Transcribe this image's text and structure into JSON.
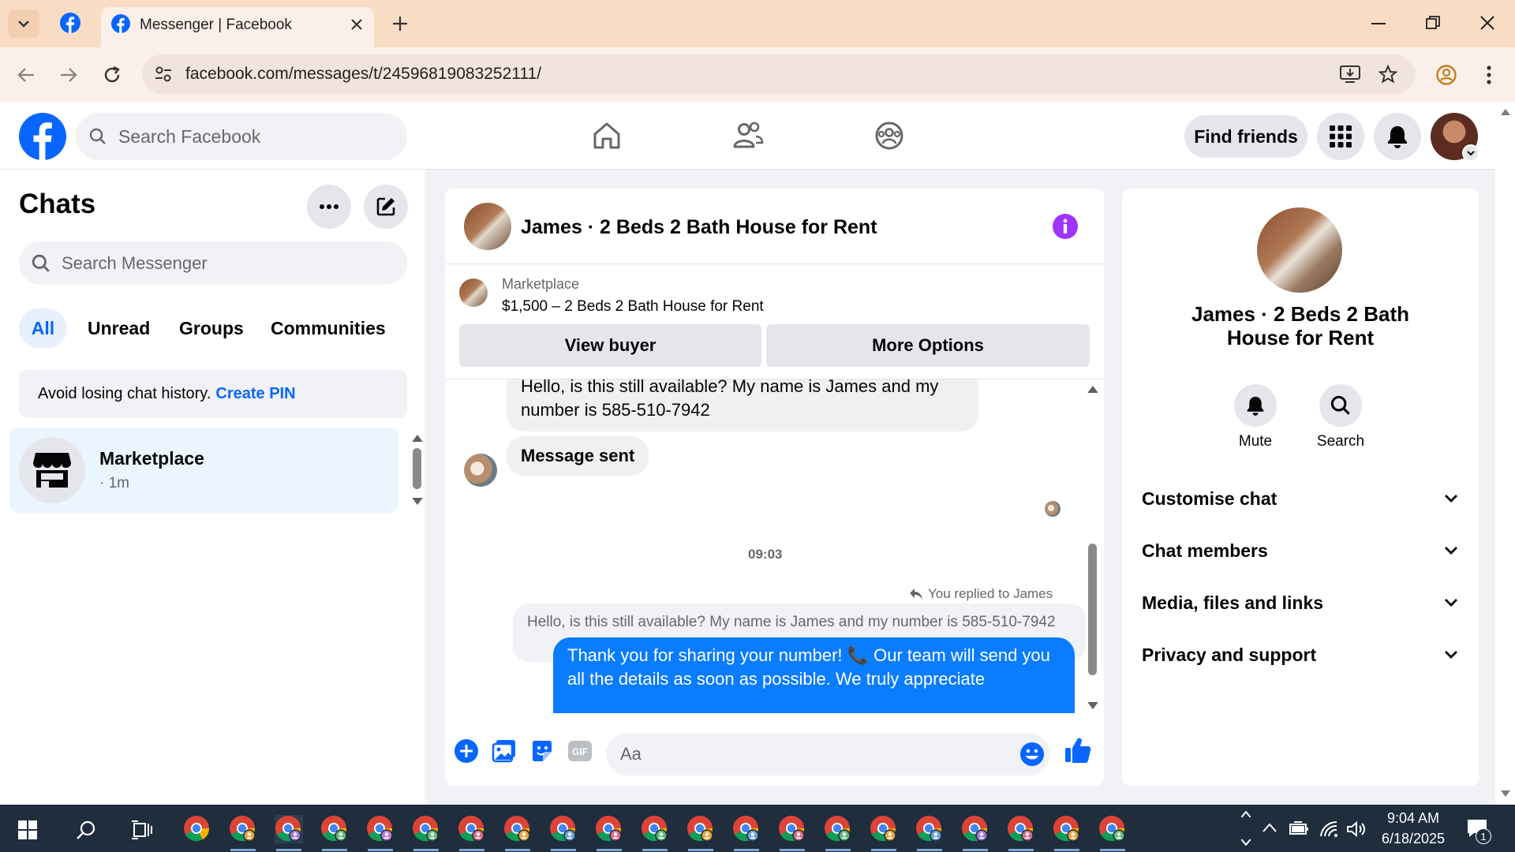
{
  "browser": {
    "tab_title": "Messenger | Facebook",
    "url": "facebook.com/messages/t/24596819083252111/"
  },
  "header": {
    "search_placeholder": "Search Facebook",
    "find_friends": "Find friends"
  },
  "sidebar": {
    "title": "Chats",
    "search_placeholder": "Search Messenger",
    "filters": [
      "All",
      "Unread",
      "Groups",
      "Communities"
    ],
    "pin_notice": "Avoid losing chat history.",
    "pin_link": "Create PIN",
    "chats": [
      {
        "name": "Marketplace",
        "time": "· 1m"
      }
    ]
  },
  "chat": {
    "title": "James · 2 Beds 2 Bath House for Rent",
    "listing_source": "Marketplace",
    "listing_title": "$1,500 – 2 Beds 2 Bath House for Rent",
    "view_buyer": "View buyer",
    "more_options": "More Options",
    "messages": {
      "incoming_1": "Hello, is this still available? My name is James and my number is 585-510-7942",
      "incoming_2": "Message sent",
      "timestamp": "09:03",
      "reply_label": "You replied to James",
      "quoted": "Hello, is this still available? My name is James and my number is 585-510-7942",
      "outgoing": "Thank you for sharing your number! 📞 Our team will send you all the details as soon as possible. We truly appreciate"
    },
    "composer_placeholder": "Aa"
  },
  "info_panel": {
    "name": "James · 2 Beds 2 Bath House for Rent",
    "mute": "Mute",
    "search": "Search",
    "sections": [
      "Customise chat",
      "Chat members",
      "Media, files and links",
      "Privacy and support"
    ]
  },
  "taskbar": {
    "time": "9:04 AM",
    "date": "6/18/2025",
    "notification_count": "1"
  },
  "colors": {
    "accent": "#0a7cff",
    "fb_blue": "#0866ff",
    "info_purple": "#a033ff"
  }
}
